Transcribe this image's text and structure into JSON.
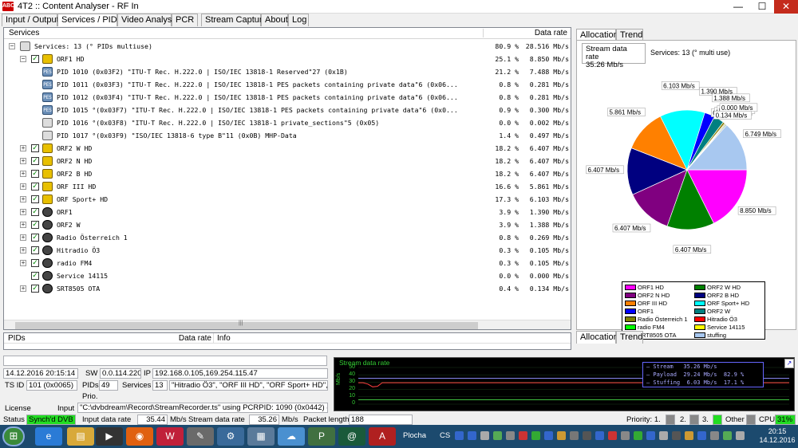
{
  "window": {
    "icon_text": "ABC",
    "title": "4T2 :: Content Analyser - RF In",
    "min_glyph": "—",
    "max_glyph": "☐",
    "close_glyph": "✕"
  },
  "tabs": [
    "Input / Output",
    "Services / PIDs",
    "Video Analysis",
    "PCR",
    "Stream Capture",
    "About",
    "Log"
  ],
  "services_header": {
    "name": "Services",
    "rate": "Data rate"
  },
  "tree": [
    {
      "text": "Services: 13 (° PIDs multiuse)",
      "pct": "80.9 %",
      "rate": "28.516 Mb/s"
    },
    {
      "text": "ORF1 HD",
      "pct": "25.1 %",
      "rate": "8.850 Mb/s"
    },
    {
      "text": "PID 1010 (0x03F2) \"ITU-T Rec. H.222.0 | ISO/IEC 13818-1 Reserved\"27 (0x1B)",
      "pct": "21.2 %",
      "rate": "7.488 Mb/s"
    },
    {
      "text": "PID 1011 (0x03F3) \"ITU-T Rec. H.222.0 | ISO/IEC 13818-1 PES packets containing private data\"6 (0x06...",
      "pct": "0.8 %",
      "rate": "0.281 Mb/s"
    },
    {
      "text": "PID 1012 (0x03F4) \"ITU-T Rec. H.222.0 | ISO/IEC 13818-1 PES packets containing private data\"6 (0x06...",
      "pct": "0.8 %",
      "rate": "0.281 Mb/s"
    },
    {
      "text": "PID 1015 °(0x03F7) \"ITU-T Rec. H.222.0 | ISO/IEC 13818-1 PES packets containing private data\"6 (0x0...",
      "pct": "0.9 %",
      "rate": "0.300 Mb/s"
    },
    {
      "text": "PID 1016 °(0x03F8) \"ITU-T Rec. H.222.0 | ISO/IEC 13818-1 private_sections\"5 (0x05)",
      "pct": "0.0 %",
      "rate": "0.002 Mb/s"
    },
    {
      "text": "PID 1017 °(0x03F9) \"ISO/IEC 13818-6 type B\"11 (0x0B) MHP-Data",
      "pct": "1.4 %",
      "rate": "0.497 Mb/s"
    },
    {
      "text": "ORF2 W HD",
      "pct": "18.2 %",
      "rate": "6.407 Mb/s"
    },
    {
      "text": "ORF2 N HD",
      "pct": "18.2 %",
      "rate": "6.407 Mb/s"
    },
    {
      "text": "ORF2 B HD",
      "pct": "18.2 %",
      "rate": "6.407 Mb/s"
    },
    {
      "text": "ORF III HD",
      "pct": "16.6 %",
      "rate": "5.861 Mb/s"
    },
    {
      "text": "ORF Sport+ HD",
      "pct": "17.3 %",
      "rate": "6.103 Mb/s"
    },
    {
      "text": "ORF1",
      "pct": "3.9 %",
      "rate": "1.390 Mb/s"
    },
    {
      "text": "ORF2 W",
      "pct": "3.9 %",
      "rate": "1.388 Mb/s"
    },
    {
      "text": "Radio Österreich 1",
      "pct": "0.8 %",
      "rate": "0.269 Mb/s"
    },
    {
      "text": "Hitradio Ö3",
      "pct": "0.3 %",
      "rate": "0.105 Mb/s"
    },
    {
      "text": "radio FM4",
      "pct": "0.3 %",
      "rate": "0.105 Mb/s"
    },
    {
      "text": "Service 14115",
      "pct": "0.0 %",
      "rate": "0.000 Mb/s"
    },
    {
      "text": "SRT8505 OTA",
      "pct": "0.4 %",
      "rate": "0.134 Mb/s"
    }
  ],
  "tree_icon_labels": {
    "pid": "PES",
    "expand_plus": "+",
    "expand_minus": "−",
    "check": "✓"
  },
  "scroll_grip": "|||",
  "pids_header": {
    "pids": "PIDs",
    "rate": "Data rate",
    "info": "Info"
  },
  "right_tabs": [
    "Allocation",
    "Trend"
  ],
  "allocation": {
    "rate_label": "Stream data rate",
    "rate_value": "35.26 Mb/s",
    "services_caption": "Services: 13 (° multi use)"
  },
  "chart_data": {
    "type": "pie",
    "series": [
      {
        "name": "ORF1 HD",
        "value": 8.85,
        "color": "#ff00ff",
        "label": "8.850 Mb/s"
      },
      {
        "name": "ORF2 W HD",
        "value": 6.407,
        "color": "#008000",
        "label": "6.407 Mb/s"
      },
      {
        "name": "ORF2 N HD",
        "value": 6.407,
        "color": "#800080",
        "label": "6.407 Mb/s"
      },
      {
        "name": "ORF2 B HD",
        "value": 6.407,
        "color": "#000080",
        "label": "6.407 Mb/s"
      },
      {
        "name": "ORF III HD",
        "value": 5.861,
        "color": "#ff8000",
        "label": "5.861 Mb/s"
      },
      {
        "name": "ORF Sport+ HD",
        "value": 6.103,
        "color": "#00ffff",
        "label": "6.103 Mb/s"
      },
      {
        "name": "ORF1",
        "value": 1.39,
        "color": "#0000ff",
        "label": "1.390 Mb/s"
      },
      {
        "name": "ORF2 W",
        "value": 1.388,
        "color": "#008080",
        "label": "1.388 Mb/s"
      },
      {
        "name": "Radio Österreich 1",
        "value": 0.269,
        "color": "#808000",
        "label": "0.269 Mb/s"
      },
      {
        "name": "Hitradio Ö3",
        "value": 0.105,
        "color": "#ff0000",
        "label": "0.105 Mb/s"
      },
      {
        "name": "radio FM4",
        "value": 0.105,
        "color": "#00ff00",
        "label": "0.105 Mb/s"
      },
      {
        "name": "Service 14115",
        "value": 0.0,
        "color": "#ffff00",
        "label": "0.000 Mb/s"
      },
      {
        "name": "SRT8505 OTA",
        "value": 0.134,
        "color": "#808080",
        "label": "0.134 Mb/s"
      },
      {
        "name": "stuffing",
        "value": 6.749,
        "color": "#a8c8f0",
        "label": "6.749 Mb/s"
      }
    ]
  },
  "bottom": {
    "datetime": "14.12.2016 20:15:14",
    "sw_label": "SW",
    "sw_value": "0.0.114.220",
    "ip_label": "IP",
    "ip_value": "192.168.0.105,169.254.115.47",
    "tsid_label": "TS ID",
    "tsid_value": "101 (0x0065)",
    "pids_label": "PIDs",
    "pids_value": "49",
    "services_label": "Services",
    "services_value": "13",
    "services_list": "\"Hitradio Ö3\", \"ORF III HD\", \"ORF Sport+ HD\",",
    "prio_label": "Prio.",
    "license_label": "License",
    "input_label": "Input",
    "input_value": "\"C:\\dvbdream\\Record\\StreamRecorder.ts\" using PCRPID: 1090 (0x0442) ("
  },
  "graph": {
    "title": "Stream data rate",
    "ylabel": "Mb/s",
    "ticks": [
      "50",
      "40",
      "30",
      "20",
      "10",
      "0"
    ],
    "legend_lines": "— Stream   35.26 Mb/s\n— Payload  29.24 Mb/s  82.9 %\n— Stuffing  6.03 Mb/s  17.1 %",
    "corner_glyph": "↗",
    "stream_value": 35.26,
    "payload_value": 29.24,
    "stuffing_value": 6.03,
    "ymax": 50
  },
  "status": {
    "status_label": "Status",
    "status_value": "Synch'd DVB",
    "input_rate_label": "Input data rate",
    "input_rate_value": "35.44",
    "input_rate_unit": "Mb/s",
    "stream_rate_label": "Stream data rate",
    "stream_rate_value": "35.26",
    "stream_rate_unit": "Mb/s",
    "packet_label": "Packet length",
    "packet_value": "188",
    "priority_label": "Priority: 1.",
    "p2": "2.",
    "p3": "3.",
    "other_label": "Other",
    "cpu_label": "CPU",
    "cpu_value": "31%"
  },
  "taskbar": {
    "plocha": "Plocha",
    "lang": "CS",
    "time": "20:15",
    "date": "14.12.2016",
    "start_glyph": "⊞"
  }
}
